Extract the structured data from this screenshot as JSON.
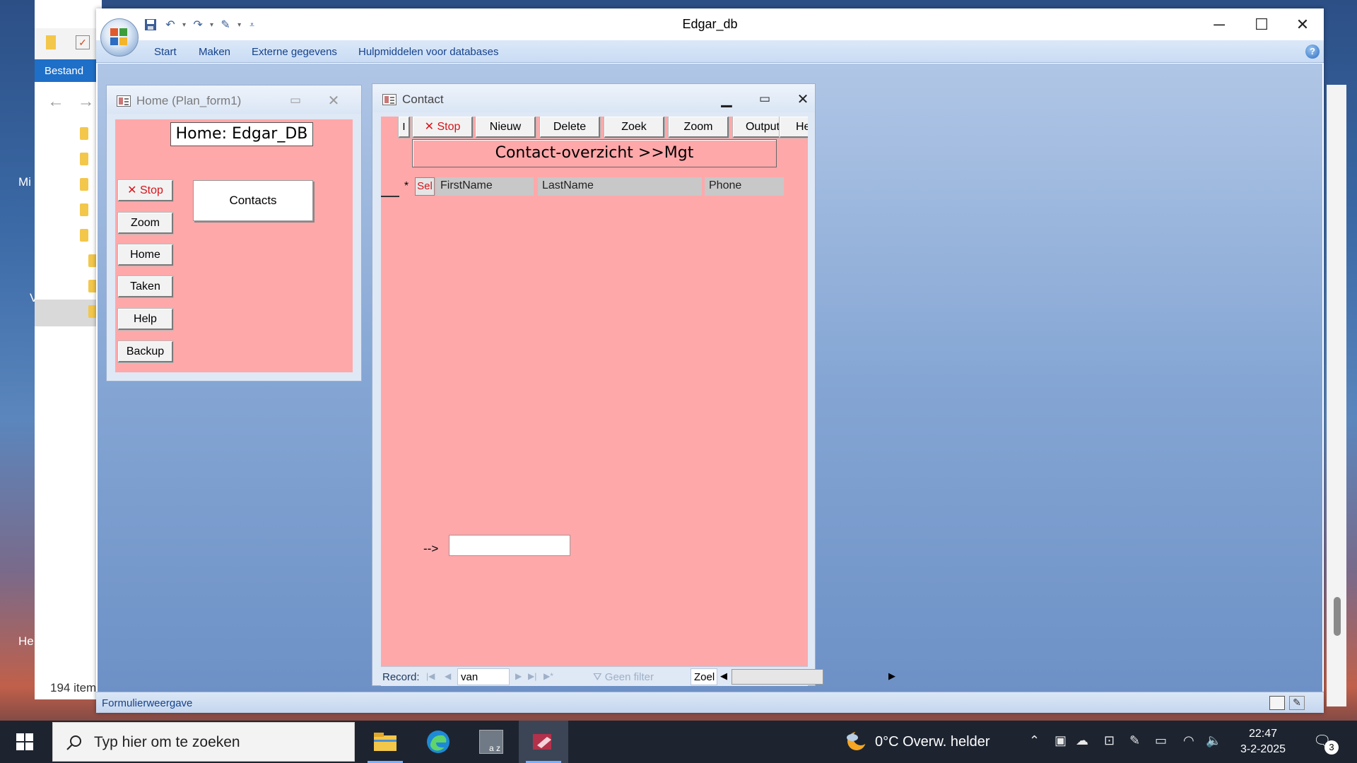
{
  "explorer": {
    "ribbon_tab": "Bestand",
    "item_count": "194 item",
    "edge_labels": [
      "Mi",
      "V",
      "He"
    ]
  },
  "app": {
    "title": "Edgar_db",
    "menu": [
      "Start",
      "Maken",
      "Externe gegevens",
      "Hulpmiddelen voor databases"
    ],
    "help_symbol": "?"
  },
  "home_form": {
    "title": "Home (Plan_form1)",
    "heading": "Home: Edgar_DB",
    "buttons": {
      "stop": "Stop",
      "zoom": "Zoom",
      "home": "Home",
      "taken": "Taken",
      "help": "Help",
      "backup": "Backup"
    },
    "contacts_label": "Contacts"
  },
  "contact_form": {
    "title": "Contact",
    "toolbar": {
      "first": "I",
      "stop": "Stop",
      "nieuw": "Nieuw",
      "delete": "Delete",
      "zoek": "Zoek",
      "zoom": "Zoom",
      "output": "Output",
      "help_partial": "Hel"
    },
    "heading": "Contact-overzicht   >>Mgt",
    "new_record_marker": "*",
    "select_button": "Sel",
    "columns": [
      "FirstName",
      "LastName",
      "Phone"
    ],
    "arrow_label": "-->",
    "input_value": ""
  },
  "record_nav": {
    "label": "Record:",
    "van": "van",
    "filter": "Geen filter",
    "search": "Zoel"
  },
  "statusbar": {
    "text": "Formulierweergave"
  },
  "taskbar": {
    "search_placeholder": "Typ hier om te zoeken",
    "weather": "0°C  Overw. helder",
    "time": "22:47",
    "date": "3-2-2025",
    "notifications": "3"
  },
  "colors": {
    "form_pink": "#ffa8aa",
    "stop_red": "#d4151b",
    "menu_blue": "#15428b",
    "taskbar": "#1d2430"
  }
}
